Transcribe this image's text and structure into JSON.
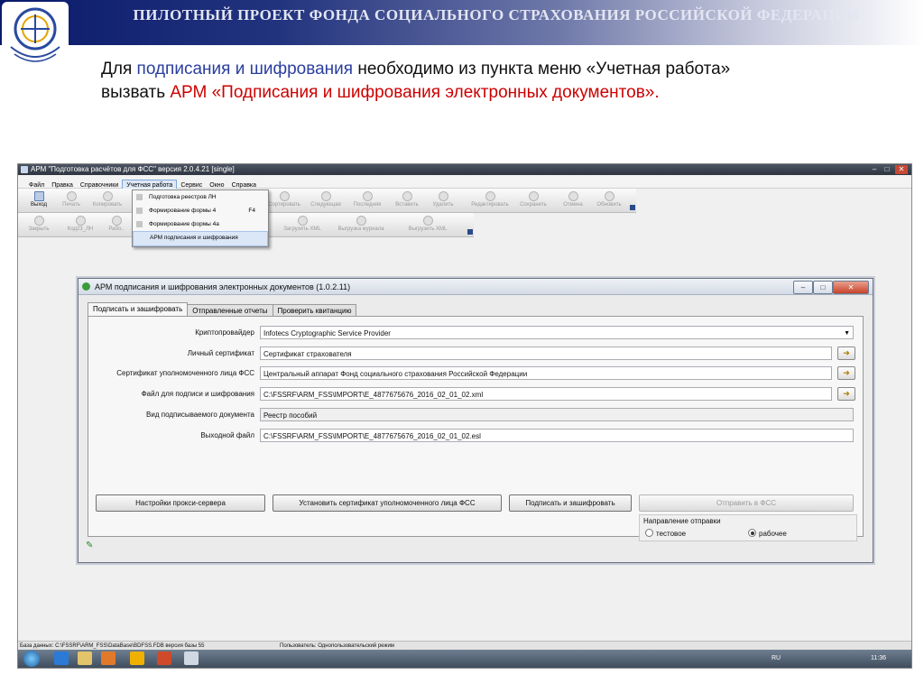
{
  "slide": {
    "title": "ПИЛОТНЫЙ ПРОЕКТ ФОНДА СОЦИАЛЬНОГО СТРАХОВАНИЯ РОССИЙСКОЙ ФЕДЕРАЦИИ",
    "text_part1": "Для ",
    "text_part2": "подписания и шифрования",
    "text_part3": " необходимо из пункта меню «Учетная работа» вызвать ",
    "text_part4": "АРМ «Подписания и шифрования электронных документов»."
  },
  "app": {
    "title": "АРМ \"Подготовка расчётов для ФСС\"  версия 2.0.4.21 [single]",
    "window_controls": {
      "minimize": "–",
      "maximize": "□",
      "close": "✕"
    },
    "menu": [
      "Файл",
      "Правка",
      "Справочники",
      "Учетная работа",
      "Сервис",
      "Окно",
      "Справка"
    ],
    "toolbar1": [
      "Выход",
      "Печать",
      "Копировать",
      "",
      "",
      "",
      "",
      "",
      "Сортировать",
      "Следующая",
      "Последняя",
      "Вставить",
      "Удалить",
      "Редактировать",
      "Сохранить",
      "Отмена",
      "Обновить"
    ],
    "toolbar2": [
      "Закрыть",
      "Код23_ЛН",
      "Рабо..",
      "",
      "",
      "",
      "",
      "Загрузить XML",
      "Выгрузка журнала",
      "Выгрузить XML"
    ],
    "dropdown": [
      {
        "label": "Подготовка реестров ЛН",
        "shortcut": ""
      },
      {
        "label": "Формирование формы 4",
        "shortcut": "F4"
      },
      {
        "label": "Формирование формы 4а",
        "shortcut": ""
      },
      {
        "label": "АРМ подписания и шифрования",
        "shortcut": ""
      }
    ]
  },
  "dialog": {
    "title": "АРМ подписания и шифрования электронных документов (1.0.2.11)",
    "tabs": [
      "Подписать и зашифровать",
      "Отправленные отчеты",
      "Проверить квитанцию"
    ],
    "fields": {
      "crypto_provider": {
        "label": "Криптопровайдер",
        "value": "Infotecs Cryptographic Service Provider"
      },
      "personal_cert": {
        "label": "Личный сертификат",
        "value": "Сертификат страхователя"
      },
      "fss_cert": {
        "label": "Сертификат уполномоченного лица ФСС",
        "value": "Центральный аппарат Фонд социального страхования Российской Федерации"
      },
      "input_file": {
        "label": "Файл для подписи и шифрования",
        "value": "C:\\FSSRF\\ARM_FSS\\IMPORT\\E_4877675676_2016_02_01_02.xml"
      },
      "doc_type": {
        "label": "Вид подписываемого документа",
        "value": "Реестр пособий"
      },
      "output_file": {
        "label": "Выходной файл",
        "value": "C:\\FSSRF\\ARM_FSS\\IMPORT\\E_4877675676_2016_02_01_02.esl"
      }
    },
    "buttons": {
      "proxy": "Настройки прокси-сервера",
      "install_cert": "Установить сертификат уполномоченного лица ФСС",
      "sign_encrypt": "Подписать и зашифровать",
      "send": "Отправить в ФСС"
    },
    "send_direction": {
      "label": "Направление отправки",
      "options": [
        "тестовое",
        "рабочее"
      ],
      "selected": "рабочее"
    }
  },
  "status": {
    "db": "База данных: C:\\FSSRF\\ARM_FSS\\DataBase\\BDFSS.FDB  версия базы 55",
    "user": "Пользователь: Однопользовательский режим"
  },
  "taskbar": {
    "lang": "RU",
    "time": "11:36"
  },
  "colors": {
    "highlight": "#cc0000",
    "header_start": "#0a1a6b"
  }
}
